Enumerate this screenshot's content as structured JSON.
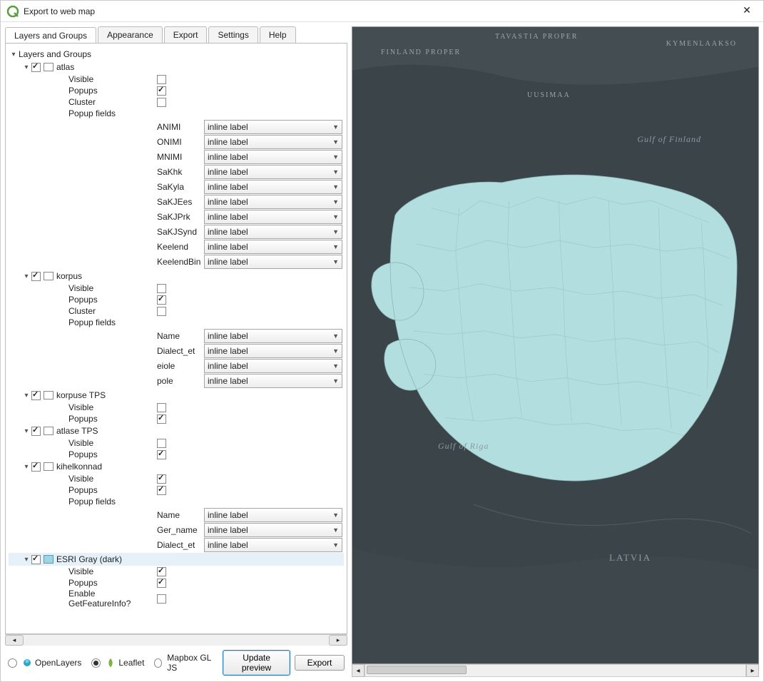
{
  "window": {
    "title": "Export to web map"
  },
  "tabs": [
    "Layers and Groups",
    "Appearance",
    "Export",
    "Settings",
    "Help"
  ],
  "active_tab": 0,
  "tree": {
    "root_label": "Layers and Groups",
    "layers": [
      {
        "name": "atlas",
        "checked": true,
        "props": {
          "Visible": false,
          "Popups": true,
          "Cluster": false
        },
        "popup_fields_label": "Popup fields",
        "fields": [
          "ANIMI",
          "ONIMI",
          "MNIMI",
          "SaKhk",
          "SaKyla",
          "SaKJEes",
          "SaKJPrk",
          "SaKJSynd",
          "Keelend",
          "KeelendBin"
        ],
        "field_value": "inline label"
      },
      {
        "name": "korpus",
        "checked": true,
        "props": {
          "Visible": false,
          "Popups": true,
          "Cluster": false
        },
        "popup_fields_label": "Popup fields",
        "fields": [
          "Name",
          "Dialect_et",
          "eiole",
          "pole"
        ],
        "field_value": "inline label"
      },
      {
        "name": "korpuse TPS",
        "checked": true,
        "props": {
          "Visible": false,
          "Popups": true
        }
      },
      {
        "name": "atlase TPS",
        "checked": true,
        "props": {
          "Visible": false,
          "Popups": true
        }
      },
      {
        "name": "kihelkonnad",
        "checked": true,
        "props": {
          "Visible": true,
          "Popups": true
        },
        "popup_fields_label": "Popup fields",
        "fields": [
          "Name",
          "Ger_name",
          "Dialect_et"
        ],
        "field_value": "inline label"
      },
      {
        "name": "ESRI Gray (dark)",
        "checked": true,
        "blue_icon": true,
        "selected": true,
        "props": {
          "Visible": true,
          "Popups": true,
          "Enable GetFeatureInfo?": false
        }
      }
    ]
  },
  "labels": {
    "visible": "Visible",
    "popups": "Popups",
    "cluster": "Cluster",
    "popup_fields": "Popup fields",
    "enable_gfi": "Enable GetFeatureInfo?"
  },
  "engines": [
    {
      "name": "OpenLayers",
      "checked": false
    },
    {
      "name": "Leaflet",
      "checked": true
    },
    {
      "name": "Mapbox GL JS",
      "checked": false
    }
  ],
  "buttons": {
    "update_preview": "Update preview",
    "export": "Export"
  },
  "map_labels": {
    "tavastia": "TAVASTIA PROPER",
    "finland_proper": "FINLAND PROPER",
    "kymenlaakso": "KYMENLAAKSO",
    "uusimaa": "UUSIMAA",
    "gulf_finland": "Gulf of Finland",
    "gulf_riga": "Gulf of Riga",
    "latvia": "LATVIA"
  }
}
